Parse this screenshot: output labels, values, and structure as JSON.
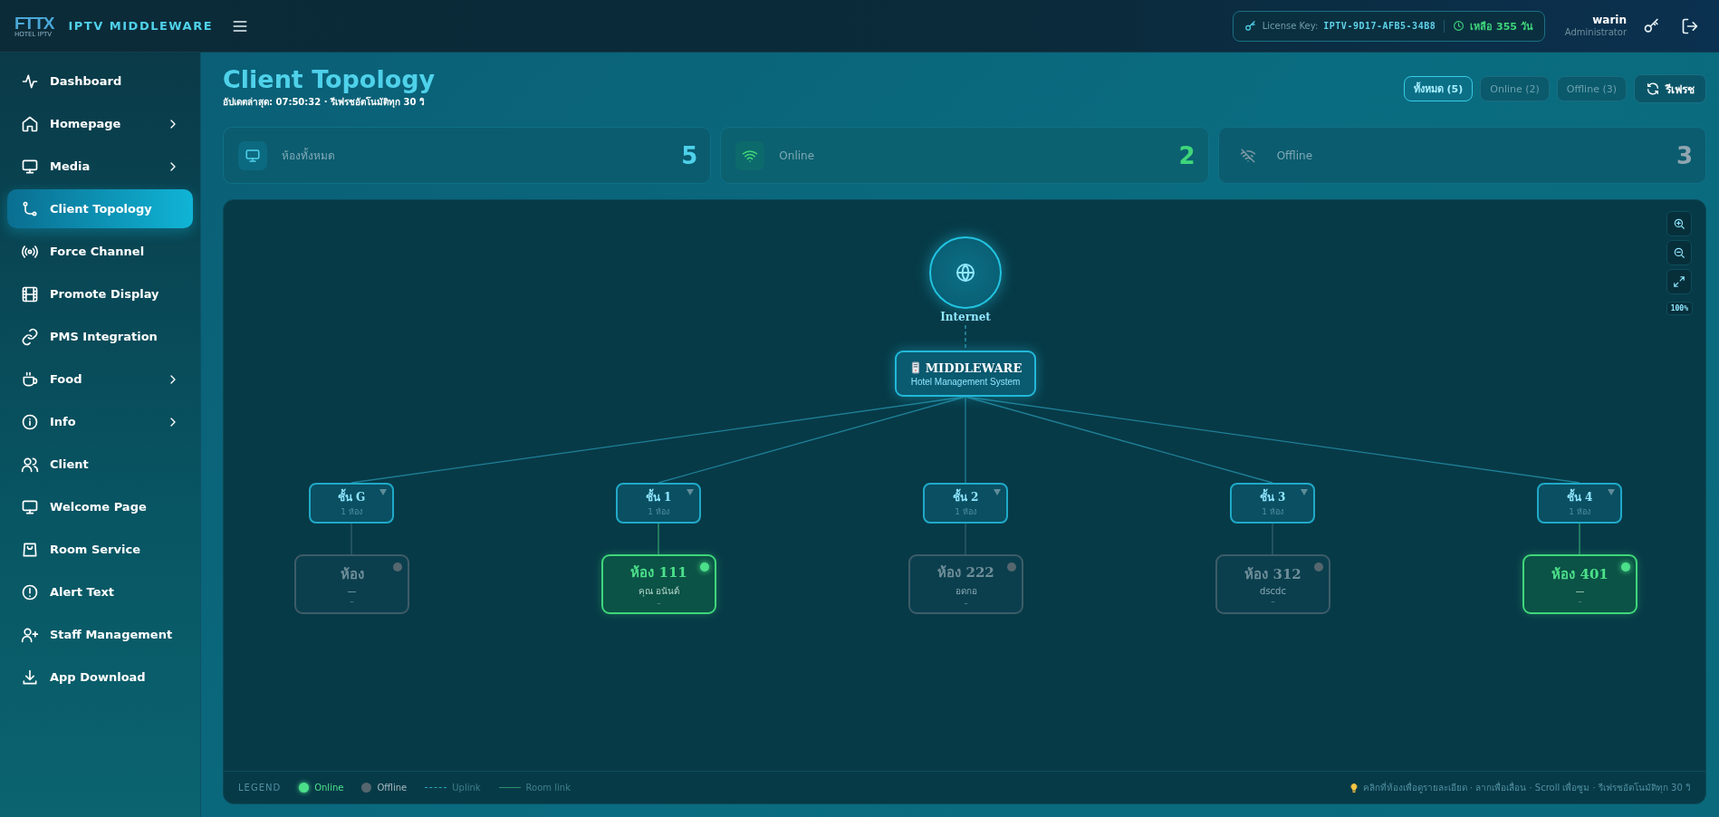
{
  "header": {
    "logo": "FTTX",
    "logo_caption": "HOTEL IPTV",
    "app_name": "IPTV MIDDLEWARE",
    "license_label": "License Key:",
    "license_key": "IPTV-9D17-AFB5-34B8",
    "days_left": "เหลือ 355 วัน",
    "user_name": "warin",
    "user_role": "Administrator"
  },
  "sidebar": {
    "items": [
      {
        "label": "Dashboard",
        "expandable": false,
        "selected": false
      },
      {
        "label": "Homepage",
        "expandable": true,
        "selected": false
      },
      {
        "label": "Media",
        "expandable": true,
        "selected": false
      },
      {
        "label": "Client Topology",
        "expandable": false,
        "selected": true
      },
      {
        "label": "Force Channel",
        "expandable": false,
        "selected": false
      },
      {
        "label": "Promote Display",
        "expandable": false,
        "selected": false
      },
      {
        "label": "PMS Integration",
        "expandable": false,
        "selected": false
      },
      {
        "label": "Food",
        "expandable": true,
        "selected": false
      },
      {
        "label": "Info",
        "expandable": true,
        "selected": false
      },
      {
        "label": "Client",
        "expandable": false,
        "selected": false
      },
      {
        "label": "Welcome Page",
        "expandable": false,
        "selected": false
      },
      {
        "label": "Room Service",
        "expandable": false,
        "selected": false
      },
      {
        "label": "Alert Text",
        "expandable": false,
        "selected": false
      },
      {
        "label": "Staff Management",
        "expandable": false,
        "selected": false
      },
      {
        "label": "App Download",
        "expandable": false,
        "selected": false
      }
    ]
  },
  "page": {
    "title": "Client Topology",
    "subtitle": "อัปเดตล่าสุด: 07:50:32 · รีเฟรชอัตโนมัติทุก 30 วิ",
    "filters": [
      {
        "label": "ทั้งหมด (5)",
        "selected": true
      },
      {
        "label": "Online (2)",
        "selected": false
      },
      {
        "label": "Offline (3)",
        "selected": false
      }
    ],
    "refresh_button": "รีเฟรช"
  },
  "stats": [
    {
      "kind": "total",
      "label": "ห้องทั้งหมด",
      "value": "5"
    },
    {
      "kind": "online",
      "label": "Online",
      "value": "2"
    },
    {
      "kind": "offline",
      "label": "Offline",
      "value": "3"
    }
  ],
  "topology": {
    "internet": "Internet",
    "middleware": {
      "title": "MIDDLEWARE",
      "subtitle": "Hotel Management System"
    },
    "floors": [
      {
        "name": "ชั้น G",
        "count": "1 ห้อง",
        "rooms": [
          {
            "name": "ห้อง",
            "guest": "—",
            "detail": "–",
            "online": false
          }
        ]
      },
      {
        "name": "ชั้น 1",
        "count": "1 ห้อง",
        "rooms": [
          {
            "name": "ห้อง 111",
            "guest": "คุณ อนันต์",
            "detail": "–",
            "online": true
          }
        ]
      },
      {
        "name": "ชั้น 2",
        "count": "1 ห้อง",
        "rooms": [
          {
            "name": "ห้อง 222",
            "guest": "อดกอ",
            "detail": "–",
            "online": false
          }
        ]
      },
      {
        "name": "ชั้น 3",
        "count": "1 ห้อง",
        "rooms": [
          {
            "name": "ห้อง 312",
            "guest": "dscdc",
            "detail": "–",
            "online": false
          }
        ]
      },
      {
        "name": "ชั้น 4",
        "count": "1 ห้อง",
        "rooms": [
          {
            "name": "ห้อง 401",
            "guest": "—",
            "detail": "–",
            "online": true
          }
        ]
      }
    ],
    "zoom_level": "100%"
  },
  "legend": {
    "title": "LEGEND",
    "items": [
      {
        "kind": "online",
        "label": "Online"
      },
      {
        "kind": "offline",
        "label": "Offline"
      },
      {
        "kind": "uplink",
        "label": "Uplink"
      },
      {
        "kind": "room_link",
        "label": "Room link"
      }
    ],
    "hint": "คลิกที่ห้องเพื่อดูรายละเอียด · ลากเพื่อเลื่อน · Scroll เพื่อซูม · รีเฟรชอัตโนมัติทุก 30 วิ"
  }
}
